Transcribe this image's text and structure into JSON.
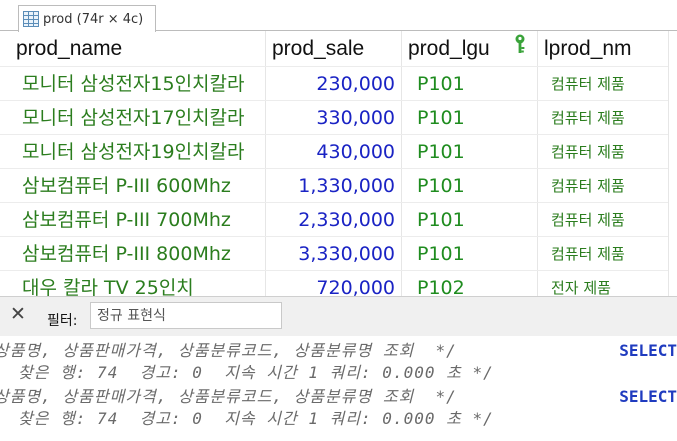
{
  "tab": {
    "title": "prod (74r × 4c)"
  },
  "columns": [
    "prod_name",
    "prod_sale",
    "prod_lgu",
    "lprod_nm"
  ],
  "rows": [
    {
      "name": "모니터 삼성전자15인치칼라",
      "sale": "230,000",
      "lgu": "P101",
      "nm": "컴퓨터 제품"
    },
    {
      "name": "모니터 삼성전자17인치칼라",
      "sale": "330,000",
      "lgu": "P101",
      "nm": "컴퓨터 제품"
    },
    {
      "name": "모니터 삼성전자19인치칼라",
      "sale": "430,000",
      "lgu": "P101",
      "nm": "컴퓨터 제품"
    },
    {
      "name": "삼보컴퓨터 P-III 600Mhz",
      "sale": "1,330,000",
      "lgu": "P101",
      "nm": "컴퓨터 제품"
    },
    {
      "name": "삼보컴퓨터 P-III 700Mhz",
      "sale": "2,330,000",
      "lgu": "P101",
      "nm": "컴퓨터 제품"
    },
    {
      "name": "삼보컴퓨터 P-III 800Mhz",
      "sale": "3,330,000",
      "lgu": "P101",
      "nm": "컴퓨터 제품"
    },
    {
      "name": "대우 칼라 TV 25인치",
      "sale": "720,000",
      "lgu": "P102",
      "nm": "전자 제품"
    }
  ],
  "filter": {
    "label": "필터:",
    "placeholder": "정규 표현식"
  },
  "log": {
    "lines": [
      "상품명, 상품판매가격, 상품분류코드, 상품분류명 조회  */",
      "찾은 행: 74  경고: 0  지속 시간 1 쿼리: 0.000 초 */",
      "상품명, 상품판매가격, 상품분류코드, 상품분류명 조회  */",
      "찾은 행: 74  경고: 0  지속 시간 1 쿼리: 0.000 초 */"
    ],
    "keyword": "SELECT"
  },
  "colors": {
    "name": "#2b7d1e",
    "sale": "#1a23c4",
    "lgu": "#1f8c1f",
    "keyword": "#1f3bbf",
    "highlight": "#f2ef22"
  }
}
